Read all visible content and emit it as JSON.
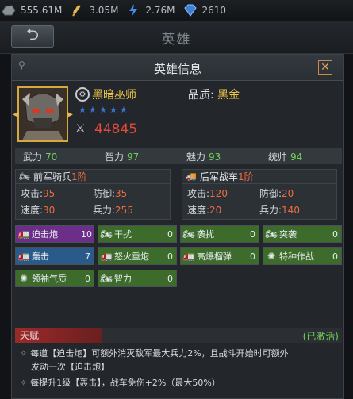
{
  "resources": [
    {
      "icon": "stone-icon",
      "value": "555.61M"
    },
    {
      "icon": "wheat-icon",
      "value": "3.05M"
    },
    {
      "icon": "lightning-icon",
      "value": "2.76M"
    },
    {
      "icon": "diamond-icon",
      "value": "2610"
    }
  ],
  "header": {
    "back_label": "⮌",
    "title": "英雄"
  },
  "dialog": {
    "title": "英雄信息"
  },
  "hero": {
    "name": "黑暗巫师",
    "stars": 5,
    "power": "44845",
    "quality_label": "品质:",
    "quality_value": "黑金"
  },
  "stats": [
    {
      "label": "武力",
      "value": "70"
    },
    {
      "label": "智力",
      "value": "97"
    },
    {
      "label": "魅力",
      "value": "93"
    },
    {
      "label": "统帅",
      "value": "94"
    }
  ],
  "troops": {
    "front": {
      "name": "前军骑兵",
      "level": "1阶",
      "attack_label": "攻击:",
      "attack": "95",
      "defense_label": "防御:",
      "defense": "35",
      "speed_label": "速度:",
      "speed": "30",
      "force_label": "兵力:",
      "force": "255"
    },
    "rear": {
      "name": "后军战车",
      "level": "1阶",
      "attack_label": "攻击:",
      "attack": "120",
      "defense_label": "防御:",
      "defense": "20",
      "speed_label": "速度:",
      "speed": "20",
      "force_label": "兵力:",
      "force": "140"
    }
  },
  "skills": [
    {
      "name": "迫击炮",
      "count": "10",
      "color": "purple"
    },
    {
      "name": "干扰",
      "count": "0",
      "color": "green"
    },
    {
      "name": "袭扰",
      "count": "0",
      "color": "green"
    },
    {
      "name": "突袭",
      "count": "0",
      "color": "green"
    },
    {
      "name": "轰击",
      "count": "7",
      "color": "blue"
    },
    {
      "name": "怒火重炮",
      "count": "0",
      "color": "green"
    },
    {
      "name": "高爆榴弹",
      "count": "0",
      "color": "green"
    },
    {
      "name": "特种作战",
      "count": "0",
      "color": "green"
    },
    {
      "name": "领袖气质",
      "count": "0",
      "color": "green"
    },
    {
      "name": "智力",
      "count": "0",
      "color": "green"
    }
  ],
  "talent": {
    "label": "天赋",
    "status": "(已激活)",
    "line1": "每道【迫击炮】可额外消灭敌军最大兵力2%，且战斗开始时可额外",
    "line2": "发动一次【迫击炮】",
    "line3": "每提升1级【轰击】，战车免伤+2%（最大50%）"
  },
  "colors": {
    "accent_gold": "#f0c94a",
    "power_red": "#e24a3a",
    "stat_green": "#6fd15a",
    "level_orange": "#f06a40"
  }
}
